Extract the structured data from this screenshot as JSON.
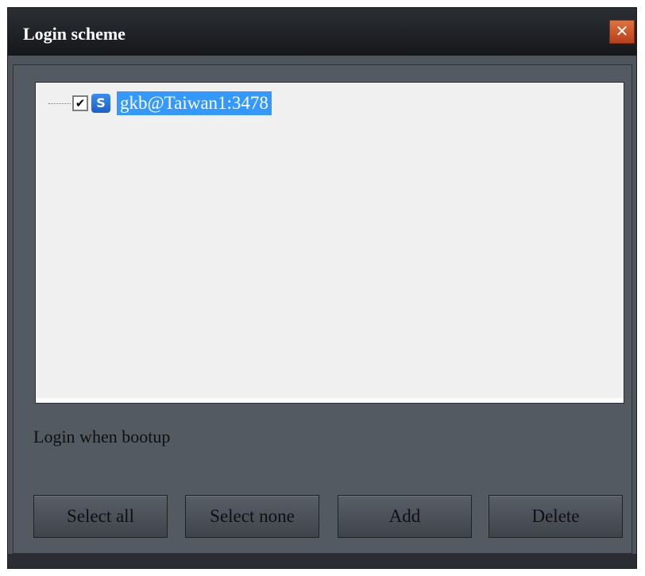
{
  "window": {
    "title": "Login scheme",
    "close_glyph": "✕"
  },
  "tree": {
    "items": [
      {
        "checked": true,
        "checkmark": "✔",
        "icon_letter": "S",
        "label": "gkb@Taiwan1:3478",
        "selected": true
      }
    ]
  },
  "login_label": "Login when bootup",
  "buttons": {
    "select_all": "Select all",
    "select_none": "Select none",
    "add": "Add",
    "delete": "Delete"
  },
  "colors": {
    "window_bg": "#4f555d",
    "selection": "#3399ff",
    "close": "#d0582a",
    "tree_bg": "#f0f0f0"
  }
}
